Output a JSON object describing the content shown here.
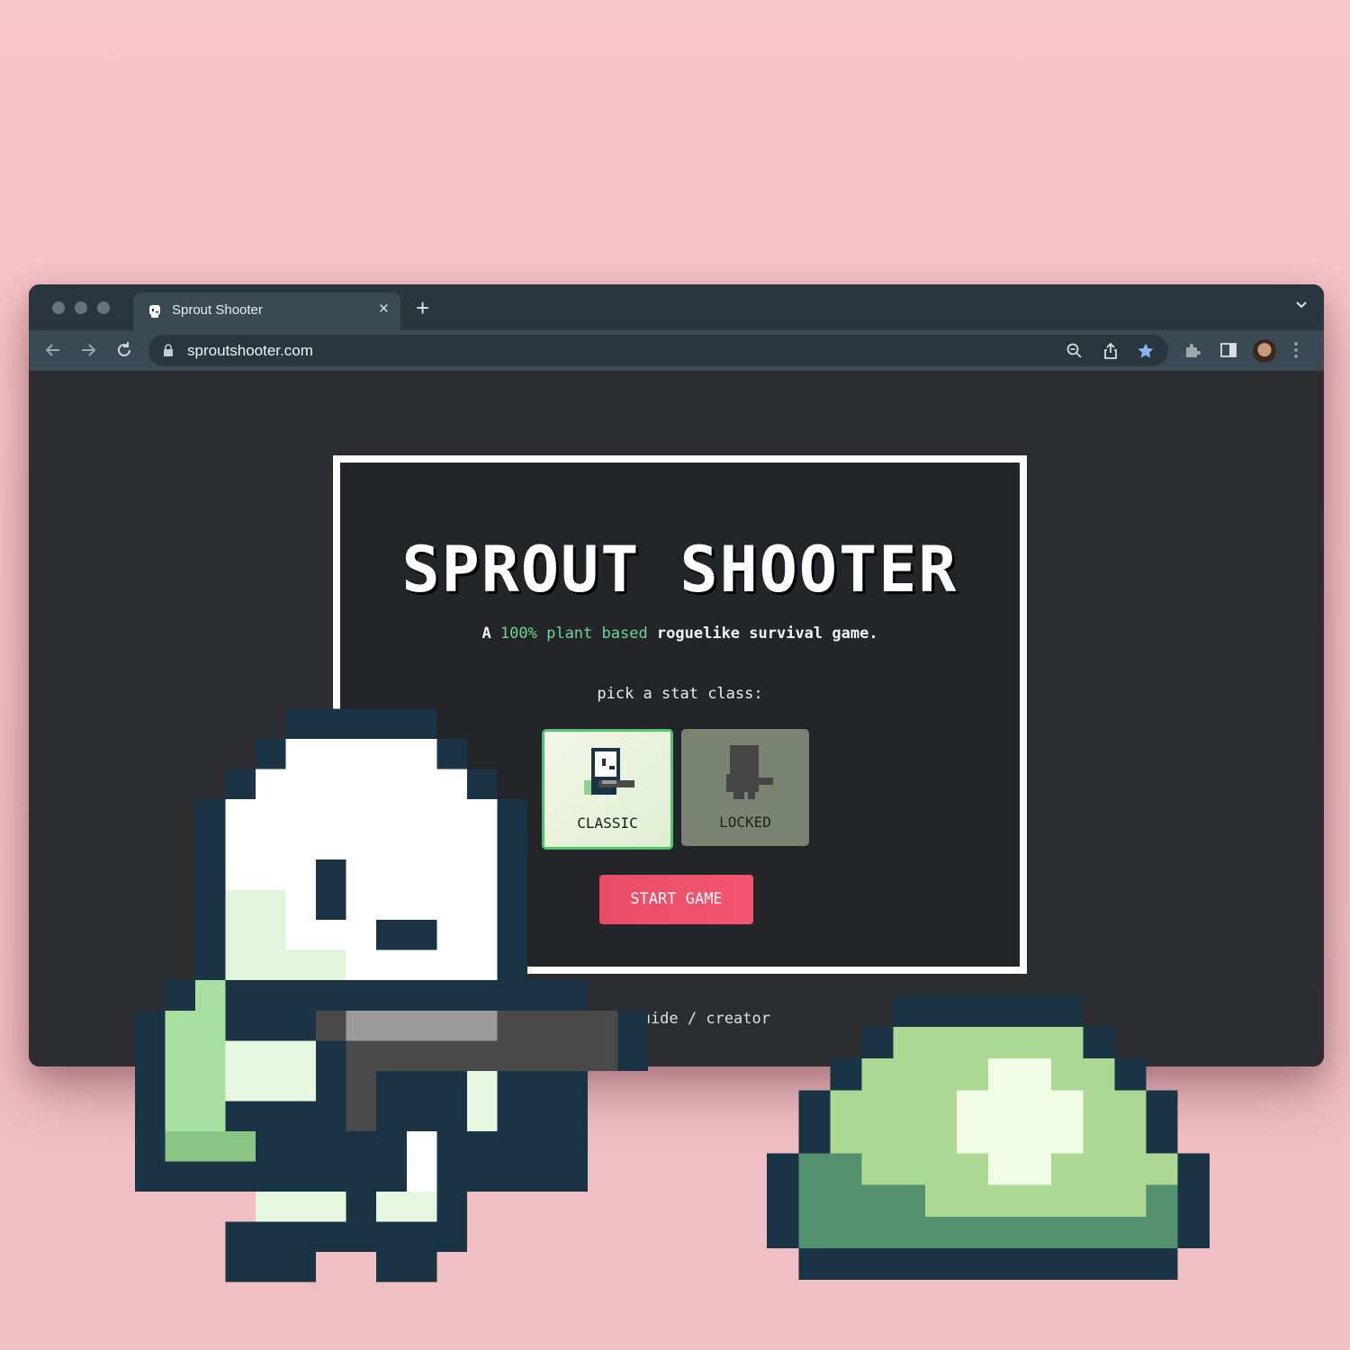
{
  "browser": {
    "tab": {
      "title": "Sprout Shooter",
      "close": "×"
    },
    "new_tab": "+",
    "address": {
      "url": "sproutshooter.com"
    },
    "icons": [
      "back-arrow-icon",
      "forward-arrow-icon",
      "reload-icon",
      "lock-icon",
      "zoom-icon",
      "share-icon",
      "bookmark-star-icon",
      "extensions-icon",
      "sidepanel-icon",
      "profile-avatar",
      "more-menu-icon"
    ]
  },
  "game": {
    "title": "SPROUT SHOOTER",
    "tagline": {
      "prefix": "A ",
      "highlight": "100% plant based",
      "suffix": " roguelike survival game."
    },
    "pick_prompt": "pick a stat class:",
    "classes": [
      {
        "label": "CLASSIC",
        "selected": true
      },
      {
        "label": "LOCKED",
        "selected": false
      }
    ],
    "start_button": "START GAME",
    "footer_links": "r guide / creator"
  },
  "colors": {
    "background": "#f8c5ca",
    "accent_green": "#6dd68c",
    "start_red": "#f4556f",
    "card_border": "#ffffff"
  }
}
